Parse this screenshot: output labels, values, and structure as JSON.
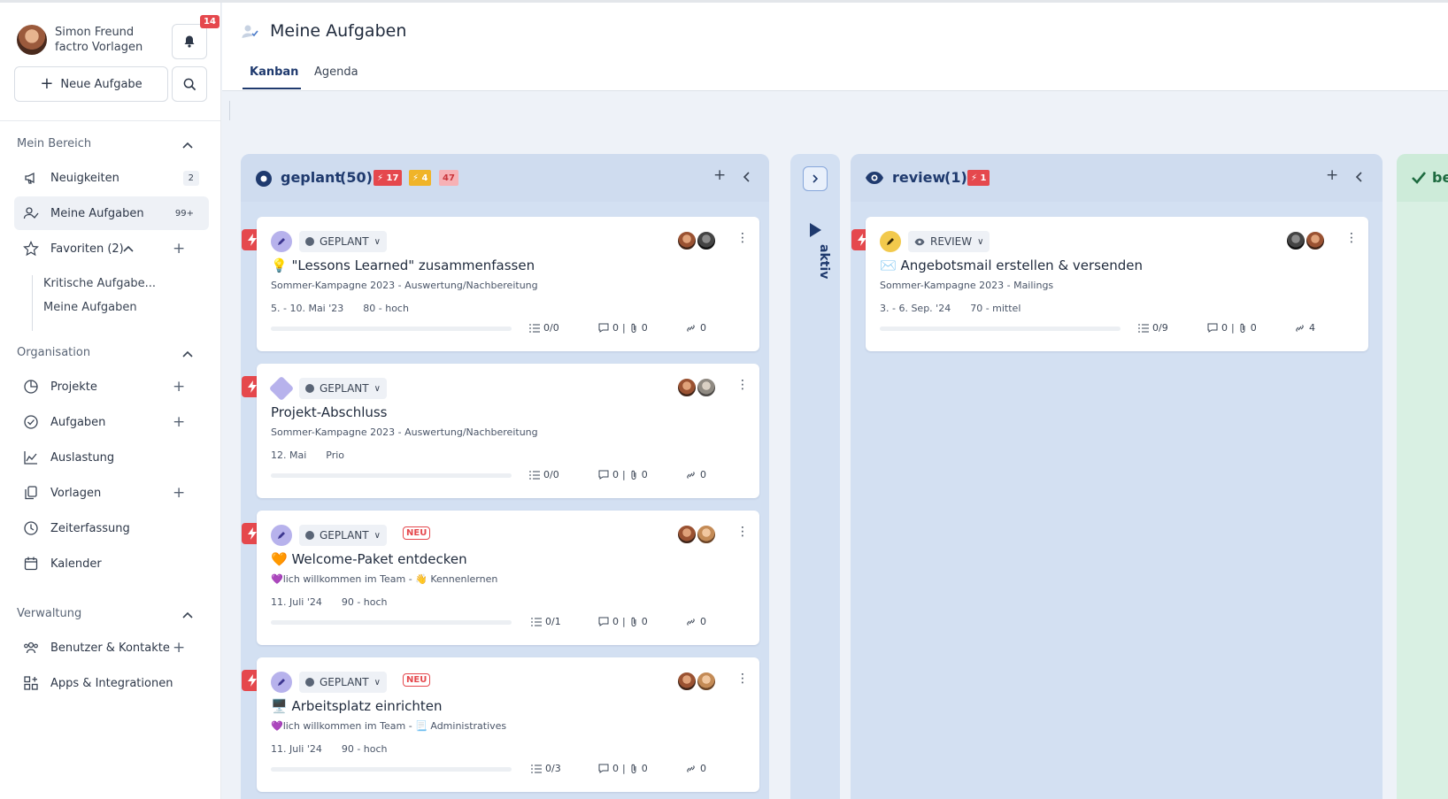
{
  "user": {
    "name": "Simon Freund",
    "org": "factro Vorlagen",
    "notifications": "14"
  },
  "sidebar": {
    "new_task_label": "Neue Aufgabe",
    "sections": {
      "mein_bereich": "Mein Bereich",
      "organisation": "Organisation",
      "verwaltung": "Verwaltung"
    },
    "items": [
      {
        "label": "Neuigkeiten",
        "badge": "2",
        "icon": "megaphone-icon"
      },
      {
        "label": "Meine Aufgaben",
        "badge": "99+",
        "icon": "user-check-icon"
      },
      {
        "label": "Favoriten (2)",
        "icon": "star-icon"
      },
      {
        "label": "Projekte",
        "icon": "pie-chart-icon"
      },
      {
        "label": "Aufgaben",
        "icon": "check-circle-icon"
      },
      {
        "label": "Auslastung",
        "icon": "area-chart-icon"
      },
      {
        "label": "Vorlagen",
        "icon": "copy-icon"
      },
      {
        "label": "Zeiterfassung",
        "icon": "clock-icon"
      },
      {
        "label": "Kalender",
        "icon": "calendar-icon"
      },
      {
        "label": "Benutzer & Kontakte",
        "icon": "users-icon"
      },
      {
        "label": "Apps & Integrationen",
        "icon": "apps-icon"
      }
    ],
    "favorites": [
      "Kritische Aufgabe...",
      "Meine Aufgaben"
    ]
  },
  "header": {
    "title": "Meine Aufgaben",
    "tabs": [
      "Kanban",
      "Agenda"
    ],
    "active_tab": "Kanban"
  },
  "columns": {
    "geplant": {
      "title": "geplant",
      "count": "(50)",
      "chip_red": "17",
      "chip_yellow": "4",
      "chip_pink": "47"
    },
    "aktiv": {
      "title": "aktiv"
    },
    "review": {
      "title": "review",
      "count": "(1)",
      "chip_red": "1"
    },
    "next": {
      "title": "be"
    }
  },
  "cards": [
    {
      "status": "GEPLANT",
      "emoji": "💡",
      "title": "\"Lessons Learned\" zusammenfassen",
      "sub": "Sommer-Kampagne 2023 - Auswertung/Nachbereitung",
      "date": "5. - 10. Mai '23",
      "prio": "80 - hoch",
      "checklist": "0/0",
      "comments": "0",
      "attachments": "0",
      "links": "0",
      "progress": 0
    },
    {
      "status": "GEPLANT",
      "title": "Projekt-Abschluss",
      "sub": "Sommer-Kampagne 2023 - Auswertung/Nachbereitung",
      "date": "12. Mai",
      "prio": "Prio",
      "checklist": "0/0",
      "comments": "0",
      "attachments": "0",
      "links": "0",
      "progress": 0
    },
    {
      "status": "GEPLANT",
      "badge": "NEU",
      "emoji": "🧡",
      "title": "Welcome-Paket entdecken",
      "sub_a": "💜lich willkommen im Team - ",
      "sub_b": "👋 Kennenlernen",
      "date": "11. Juli '24",
      "prio": "90 - hoch",
      "checklist": "0/1",
      "comments": "0",
      "attachments": "0",
      "links": "0",
      "progress": 0
    },
    {
      "status": "GEPLANT",
      "badge": "NEU",
      "emoji": "🖥️",
      "title": "Arbeitsplatz einrichten",
      "sub_a": "💜lich willkommen im Team - ",
      "sub_b": "📃 Administratives",
      "date": "11. Juli '24",
      "prio": "90 - hoch",
      "checklist": "0/3",
      "comments": "0",
      "attachments": "0",
      "links": "0",
      "progress": 0
    },
    {
      "status": "REVIEW",
      "emoji": "✉️",
      "title": "Angebotsmail erstellen & versenden",
      "sub": "Sommer-Kampagne 2023 - Mailings",
      "date": "3. - 6. Sep. '24",
      "prio": "70 - mittel",
      "checklist": "0/9",
      "comments": "0",
      "attachments": "0",
      "links": "4",
      "progress": 0
    }
  ],
  "colors": {
    "accent": "#1f3a6e",
    "urgent": "#e5484d",
    "column_bg": "#d3e0f2",
    "done_bg": "#d9f0e3"
  }
}
